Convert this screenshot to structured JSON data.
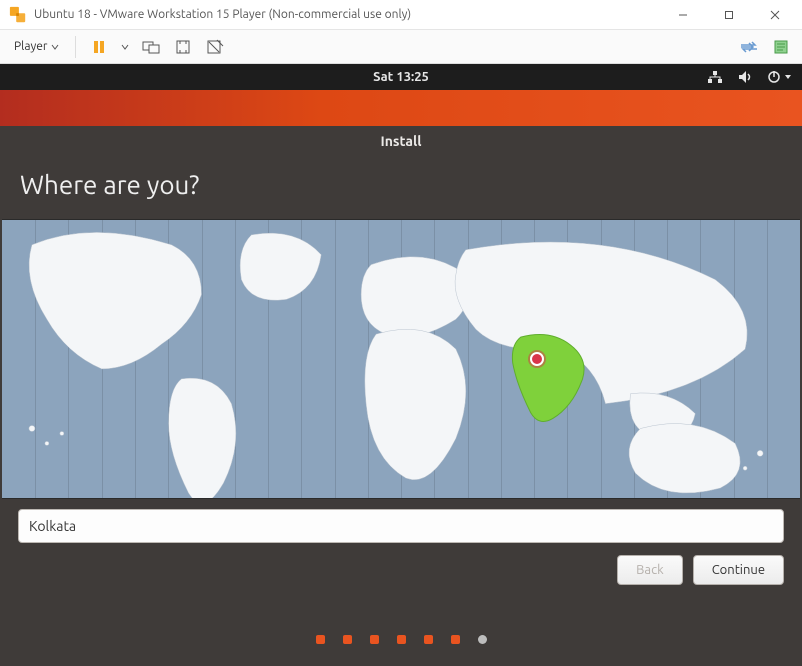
{
  "vmware": {
    "window_title": "Ubuntu 18 - VMware Workstation 15 Player (Non-commercial use only)",
    "player_menu_label": "Player"
  },
  "ubuntu": {
    "clock": "Sat 13:25"
  },
  "installer": {
    "title": "Install",
    "heading": "Where are you?",
    "timezone_value": "Kolkata",
    "back_label": "Back",
    "continue_label": "Continue",
    "pin": {
      "left_pct": 67.0,
      "top_pct": 50.0
    },
    "progress": {
      "total": 7,
      "current": 6
    }
  },
  "colors": {
    "ubuntu_orange": "#e95420",
    "map_bg": "#8ca4bd",
    "highlight_region": "#7fd13b"
  }
}
